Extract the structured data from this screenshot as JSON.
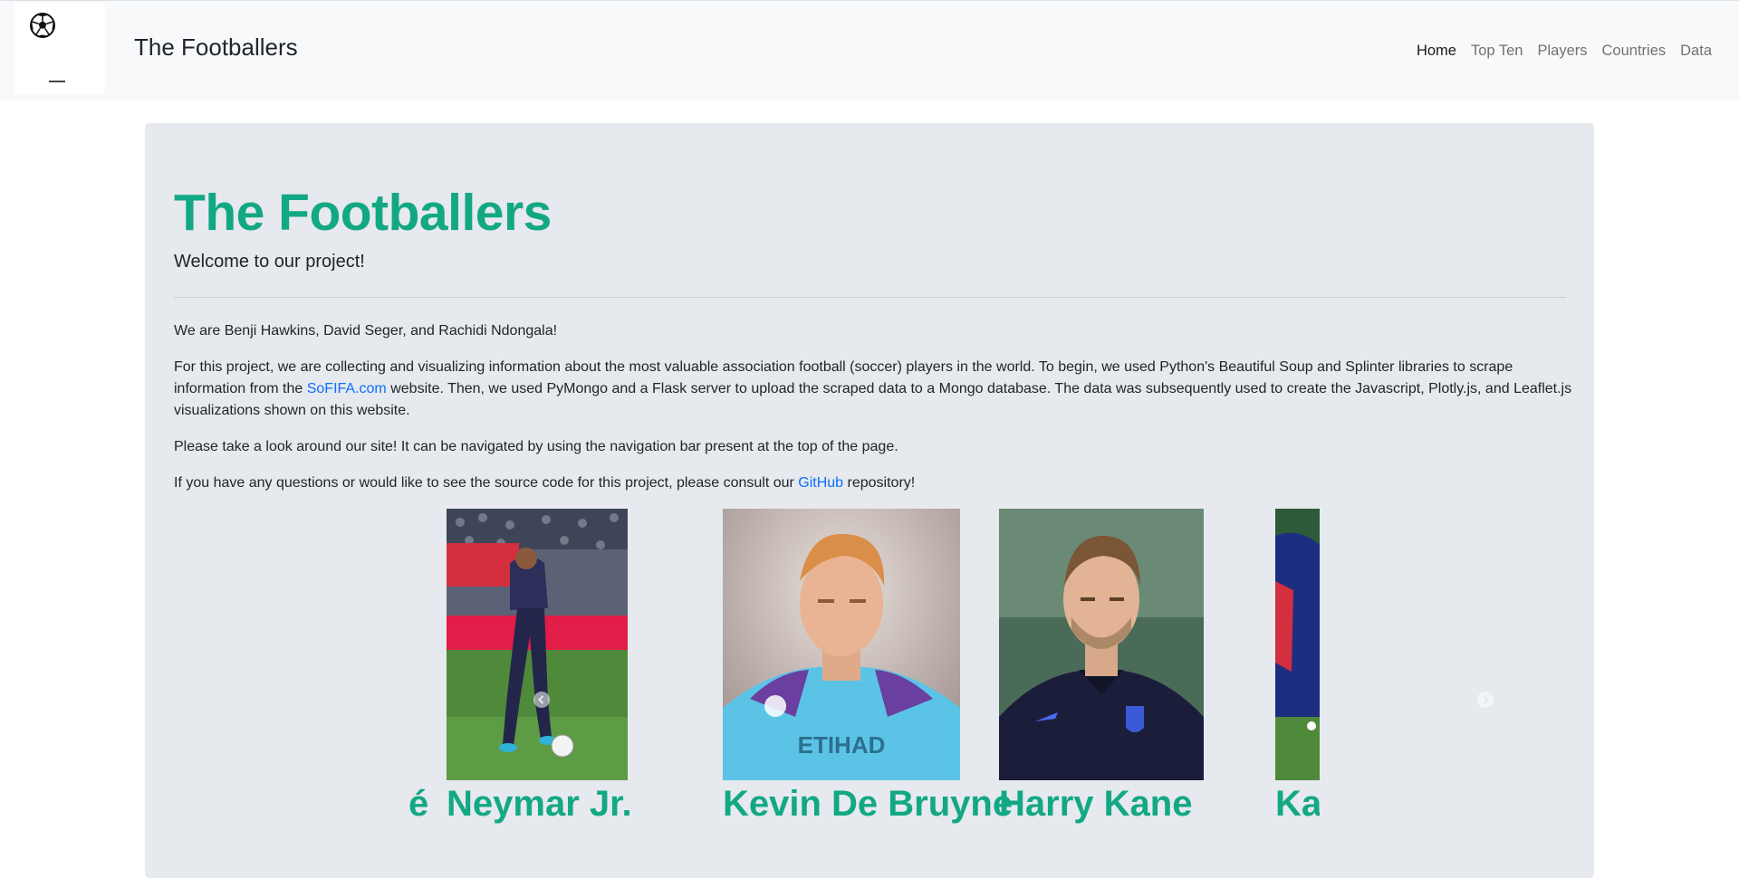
{
  "nav": {
    "brand": "The Footballers",
    "links": [
      "Home",
      "Top Ten",
      "Players",
      "Countries",
      "Data"
    ]
  },
  "hero": {
    "title": "The Footballers",
    "lead": "Welcome to our project!",
    "p1": "We are Benji Hawkins, David Seger, and Rachidi Ndongala!",
    "p2_a": "For this project, we are collecting and visualizing information about the most valuable association football (soccer) players in the world. To begin, we used Python's Beautiful Soup and Splinter libraries to scrape information from the ",
    "p2_link": "SoFIFA.com",
    "p2_b": " website. Then, we used PyMongo and a Flask server to upload the scraped data to a Mongo database. The data was subsequently used to create the Javascript, Plotly.js, and Leaflet.js visualizations shown on this website.",
    "p3": "Please take a look around our site! It can be navigated by using the navigation bar present at the top of the page.",
    "p4_a": "If you have any questions or would like to see the source code for this project, please consult our ",
    "p4_link": "GitHub",
    "p4_b": " repository!"
  },
  "carousel": {
    "slides": [
      {
        "name": "é"
      },
      {
        "name": "Neymar Jr."
      },
      {
        "name": "Kevin De Bruyne"
      },
      {
        "name": "Harry Kane"
      },
      {
        "name": "Ka"
      }
    ],
    "prev_icon": "chevron-left-icon",
    "next_icon": "chevron-right-icon"
  }
}
